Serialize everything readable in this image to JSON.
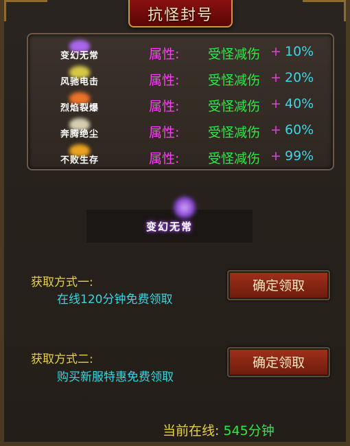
{
  "title": "抗怪封号",
  "attributes": [
    {
      "badge": "变幻无常",
      "flame_color": "#b56cff",
      "label": "属性:",
      "effect": "受怪减伤",
      "plus": "+",
      "value": "10%"
    },
    {
      "badge": "风驰电击",
      "flame_color": "#e8d84a",
      "label": "属性:",
      "effect": "受怪减伤",
      "plus": "+",
      "value": "20%"
    },
    {
      "badge": "烈焰裂爆",
      "flame_color": "#ff7a2a",
      "label": "属性:",
      "effect": "受怪减伤",
      "plus": "+",
      "value": "40%"
    },
    {
      "badge": "奔腾绝尘",
      "flame_color": "#e8e0c0",
      "label": "属性:",
      "effect": "受怪减伤",
      "plus": "+",
      "value": "60%"
    },
    {
      "badge": "不败生存",
      "flame_color": "#ffb020",
      "label": "属性:",
      "effect": "受怪减伤",
      "plus": "+",
      "value": "99%"
    }
  ],
  "preview": {
    "name": "变幻无常"
  },
  "methods": [
    {
      "title": "获取方式一:",
      "desc": "在线120分钟免费领取",
      "button": "确定领取"
    },
    {
      "title": "获取方式二:",
      "desc": "购买新服特惠免费领取",
      "button": "确定领取"
    }
  ],
  "online": {
    "label": "当前在线:",
    "value": "545分钟"
  }
}
